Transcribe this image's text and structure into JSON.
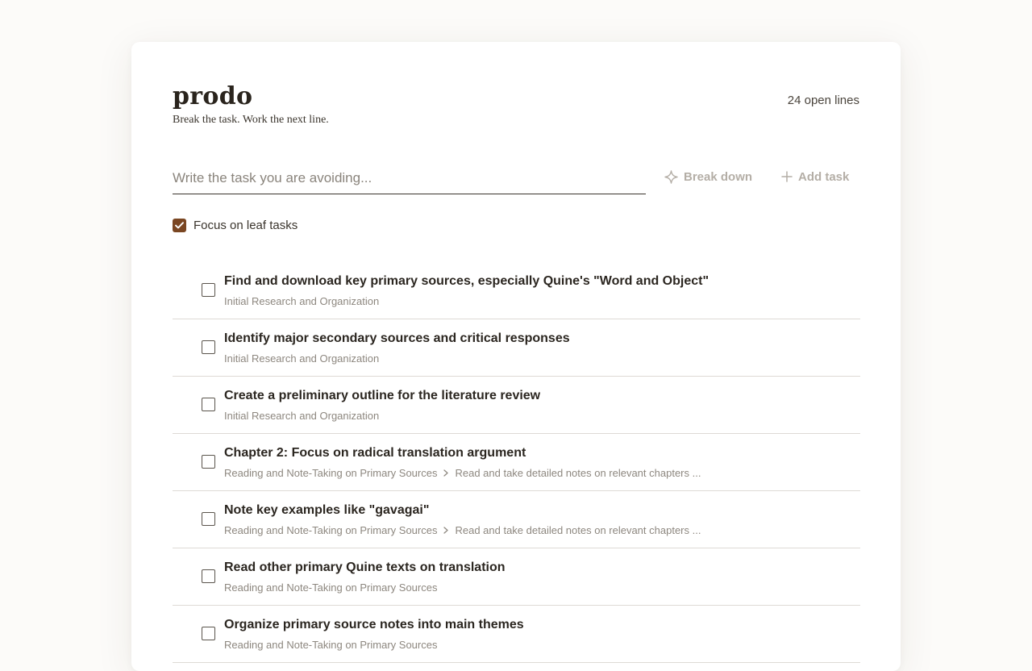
{
  "app": {
    "name": "prodo",
    "tagline": "Break the task. Work the next line.",
    "open_count": "24 open lines"
  },
  "input": {
    "placeholder": "Write the task you are avoiding...",
    "value": ""
  },
  "actions": {
    "breakdown_label": "Break down",
    "breakdown_icon": "sparkle-icon",
    "add_label": "Add task",
    "add_icon": "plus-icon"
  },
  "focus": {
    "label": "Focus on leaf tasks",
    "checked": true
  },
  "colors": {
    "accent": "#7a4622",
    "text": "#2b2620",
    "muted": "#8d877f",
    "disabled": "#b4aea6"
  },
  "tasks": [
    {
      "title": "Find and download key primary sources, especially Quine's \"Word and Object\"",
      "path": [
        "Initial Research and Organization"
      ]
    },
    {
      "title": "Identify major secondary sources and critical responses",
      "path": [
        "Initial Research and Organization"
      ]
    },
    {
      "title": "Create a preliminary outline for the literature review",
      "path": [
        "Initial Research and Organization"
      ]
    },
    {
      "title": "Chapter 2: Focus on radical translation argument",
      "path": [
        "Reading and Note-Taking on Primary Sources",
        "Read and take detailed notes on relevant chapters ..."
      ]
    },
    {
      "title": "Note key examples like \"gavagai\"",
      "path": [
        "Reading and Note-Taking on Primary Sources",
        "Read and take detailed notes on relevant chapters ..."
      ]
    },
    {
      "title": "Read other primary Quine texts on translation",
      "path": [
        "Reading and Note-Taking on Primary Sources"
      ]
    },
    {
      "title": "Organize primary source notes into main themes",
      "path": [
        "Reading and Note-Taking on Primary Sources"
      ]
    }
  ]
}
